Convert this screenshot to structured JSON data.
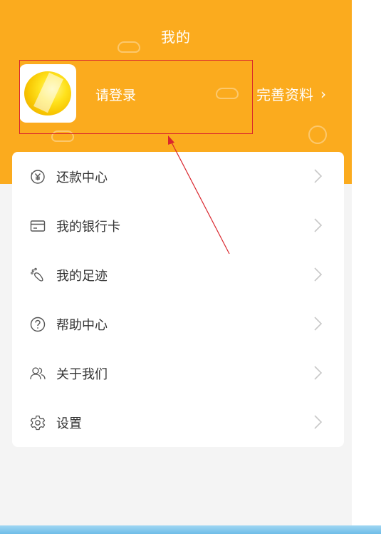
{
  "header": {
    "title": "我的",
    "login_prompt": "请登录",
    "complete_profile": "完善资料"
  },
  "menu": {
    "items": [
      {
        "label": "还款中心",
        "icon": "yuan-circle-icon"
      },
      {
        "label": "我的银行卡",
        "icon": "bank-card-icon"
      },
      {
        "label": "我的足迹",
        "icon": "footprint-icon"
      },
      {
        "label": "帮助中心",
        "icon": "help-icon"
      },
      {
        "label": "关于我们",
        "icon": "people-icon"
      },
      {
        "label": "设置",
        "icon": "gear-icon"
      }
    ]
  },
  "colors": {
    "header_bg": "#fbab1e",
    "annotation_red": "#d9262d",
    "text": "#333333",
    "chevron": "#c8c8c8"
  }
}
